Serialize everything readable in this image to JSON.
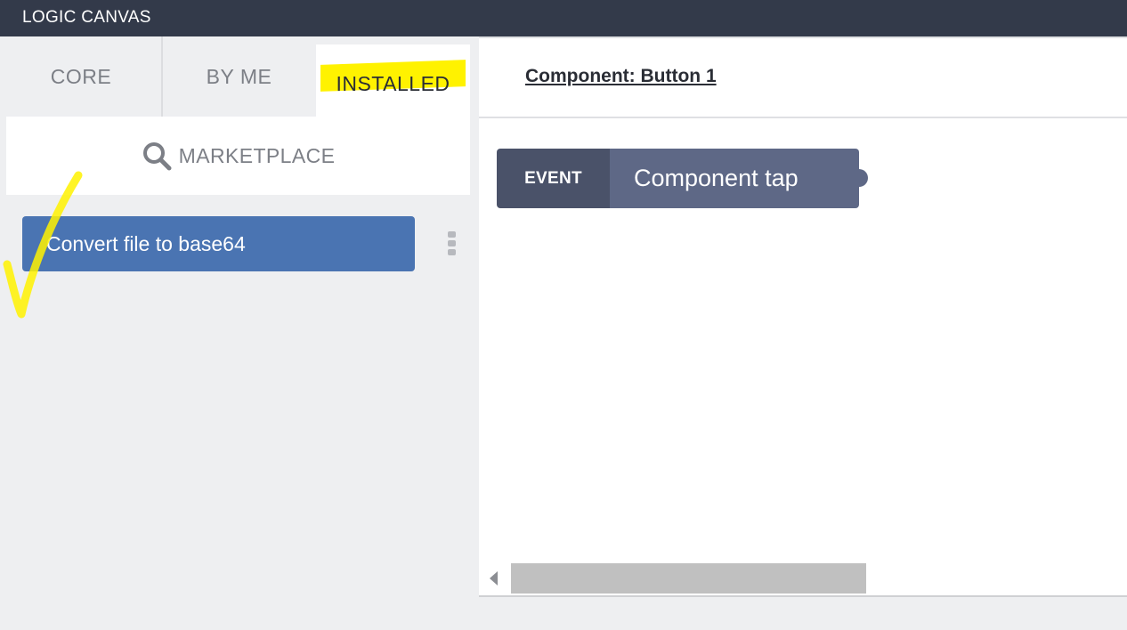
{
  "app": {
    "title": "LOGIC CANVAS"
  },
  "tabs": [
    {
      "label": "CORE",
      "active": false
    },
    {
      "label": "BY ME",
      "active": false
    },
    {
      "label": "INSTALLED",
      "active": true,
      "highlighted": true
    }
  ],
  "marketplace": {
    "icon": "search-icon",
    "label": "MARKETPLACE"
  },
  "installed_blocks": [
    {
      "label": "Convert file to base64",
      "menu_icon": "kebab-menu-icon"
    }
  ],
  "canvas": {
    "component_title": "Component: Button 1",
    "event_block": {
      "tag": "EVENT",
      "label": "Component tap"
    }
  },
  "colors": {
    "titlebar": "#333a4a",
    "block_blue": "#4a74b2",
    "event_tag": "#4a5269",
    "event_body": "#5e6886",
    "highlight": "#fff200"
  }
}
